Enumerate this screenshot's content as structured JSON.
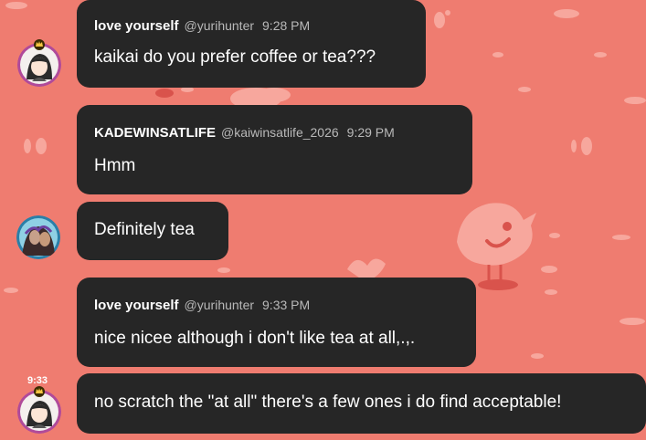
{
  "colors": {
    "background": "#ef7c70",
    "bubble": "#262626",
    "text": "#ffffff",
    "meta": "#b9b9b9"
  },
  "messages": [
    {
      "author": "love yourself",
      "handle": "@yurihunter",
      "time": "9:28 PM",
      "text": "kaikai do you prefer coffee or tea???"
    },
    {
      "author": "KADEWINSATLIFE",
      "handle": "@kaiwinsatlife_2026",
      "time": "9:29 PM",
      "text": "Hmm"
    },
    {
      "text": "Definitely tea"
    },
    {
      "author": "love yourself",
      "handle": "@yurihunter",
      "time": "9:33 PM",
      "text": "nice nicee although i don't like tea at all,.,."
    },
    {
      "hover_time": "9:33",
      "text": "no scratch the \"at all\" there's a few ones i do find acceptable!"
    }
  ],
  "icons": {
    "crown": "crown-icon",
    "bird": "bird-doodle",
    "heart": "heart-doodle"
  }
}
